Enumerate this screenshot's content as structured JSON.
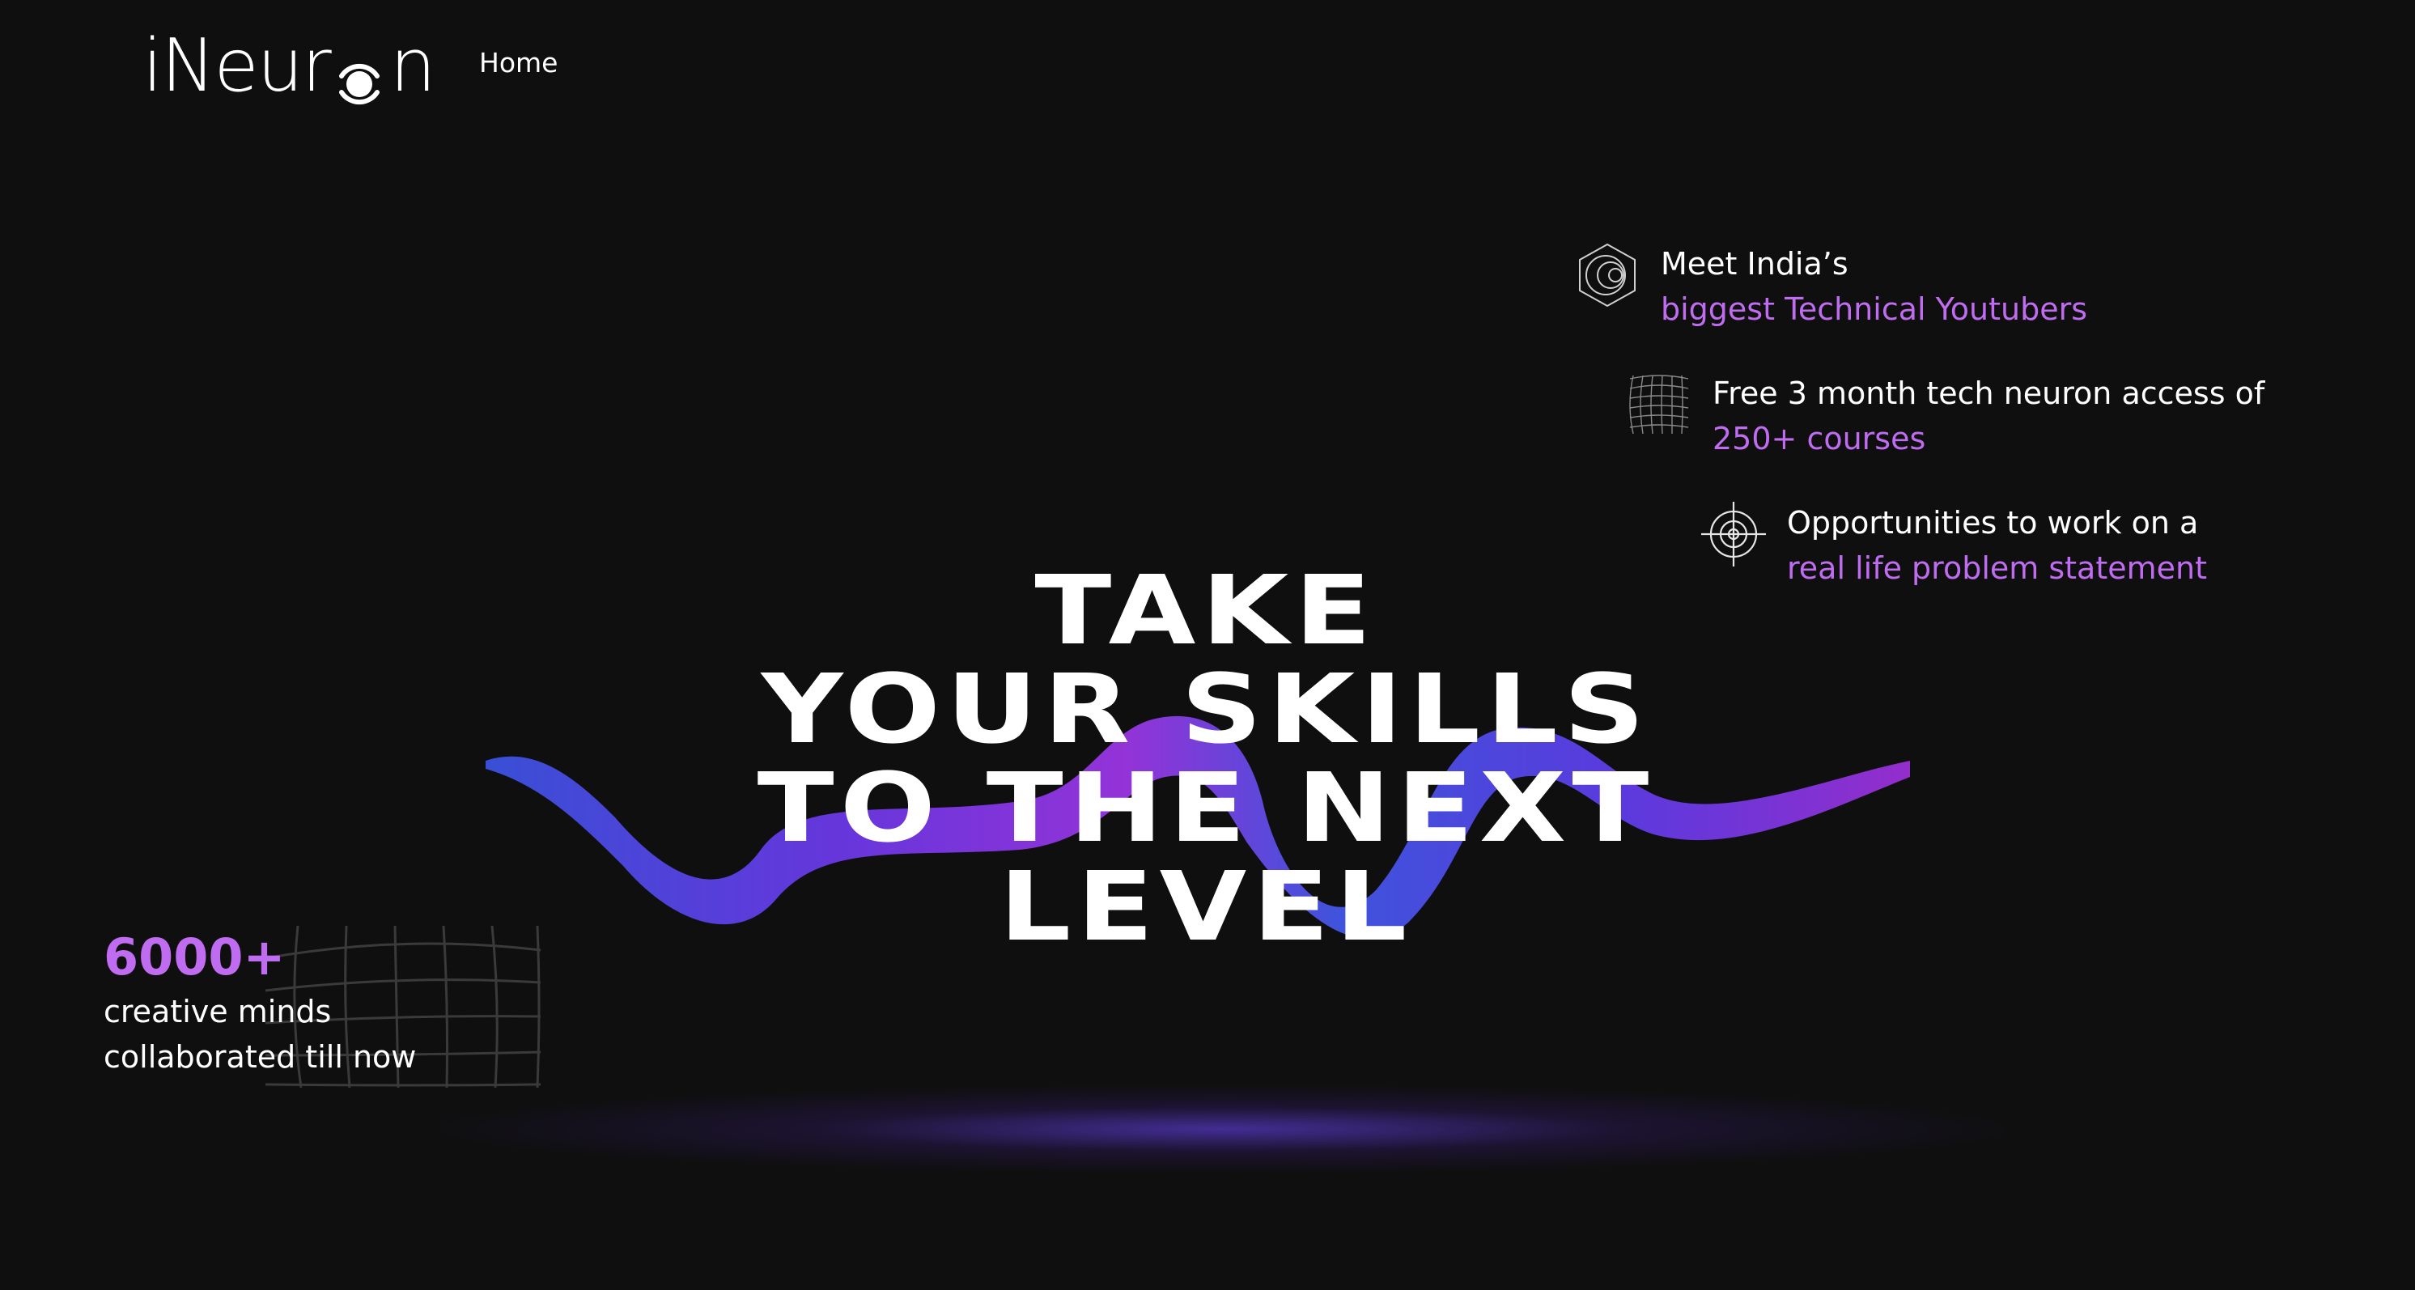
{
  "header": {
    "logo_text_prefix": "iNeur",
    "logo_text_suffix": "n",
    "nav": {
      "home_label": "Home"
    }
  },
  "hero": {
    "headline_lines": [
      "TAKE",
      "YOUR SKILLS",
      "TO THE NEXT",
      "LEVEL"
    ]
  },
  "features": [
    {
      "icon": "hexagon-rings-icon",
      "line1": "Meet India’s",
      "line2": "biggest Technical Youtubers"
    },
    {
      "icon": "mesh-grid-icon",
      "line1": "Free 3 month tech neuron access of",
      "line2": "250+ courses"
    },
    {
      "icon": "crosshair-target-icon",
      "line1": "Opportunities to work on a",
      "line2": "real life problem statement"
    }
  ],
  "stats": {
    "value": "6000+",
    "desc_line1": "creative minds",
    "desc_line2": "collaborated till now"
  },
  "colors": {
    "background": "#0f0f10",
    "accent": "#c06cf0",
    "ribbon_blue": "#3a4fd8",
    "ribbon_purple": "#8a2fd0"
  }
}
